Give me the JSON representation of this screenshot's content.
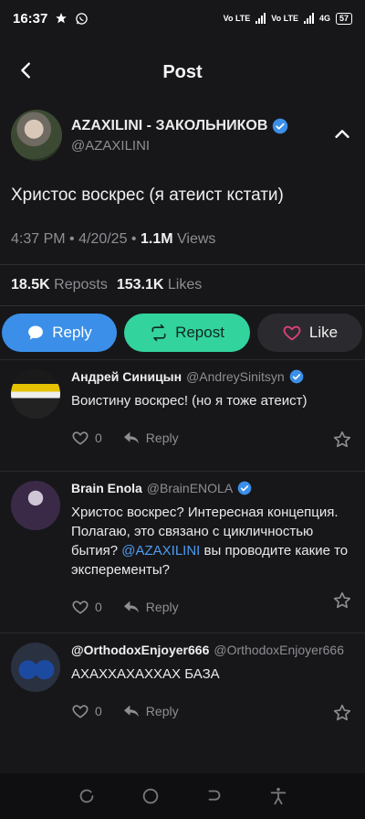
{
  "status_bar": {
    "time": "16:37",
    "network1": "Vo LTE",
    "network2": "Vo LTE",
    "speed": "4G",
    "battery": "57"
  },
  "header": {
    "title": "Post"
  },
  "post": {
    "author_name": "AZAXILINI - ЗАКОЛЬНИКОВ",
    "author_handle": "@AZAXILINI",
    "text": "Христос воскрес (я атеист кстати)",
    "time": "4:37 PM",
    "date": "4/20/25",
    "views_count": "1.1M",
    "views_label": "Views",
    "reposts_count": "18.5K",
    "reposts_label": "Reposts",
    "likes_count": "153.1K",
    "likes_label": "Likes"
  },
  "actions": {
    "reply_label": "Reply",
    "repost_label": "Repost",
    "like_label": "Like"
  },
  "comments": [
    {
      "name": "Андрей Синицын",
      "handle": "@AndreySinitsyn",
      "text": "Воистину воскрес! (но я тоже атеист)",
      "likes": "0",
      "reply_label": "Reply"
    },
    {
      "name": "Brain Enola",
      "handle": "@BrainENOLA",
      "text_before": "Христос воскрес? Интересная концепция. Полагаю, это связано с цикличностью бытия? ",
      "mention": "@AZAXILINI",
      "text_after": " вы проводите какие то эксперементы?",
      "likes": "0",
      "reply_label": "Reply"
    },
    {
      "name": "@OrthodoxEnjoyer666",
      "handle": "@OrthodoxEnjoyer666",
      "text": "АХАХХАХАХХАХ БАЗА",
      "likes": "0",
      "reply_label": "Reply"
    }
  ],
  "colors": {
    "background": "#17171a",
    "reply_button": "#3b8fe8",
    "repost_button": "#33d39d",
    "verified": "#3b8fe8",
    "mention": "#4d9cf0",
    "like_heart": "#e0407a"
  }
}
